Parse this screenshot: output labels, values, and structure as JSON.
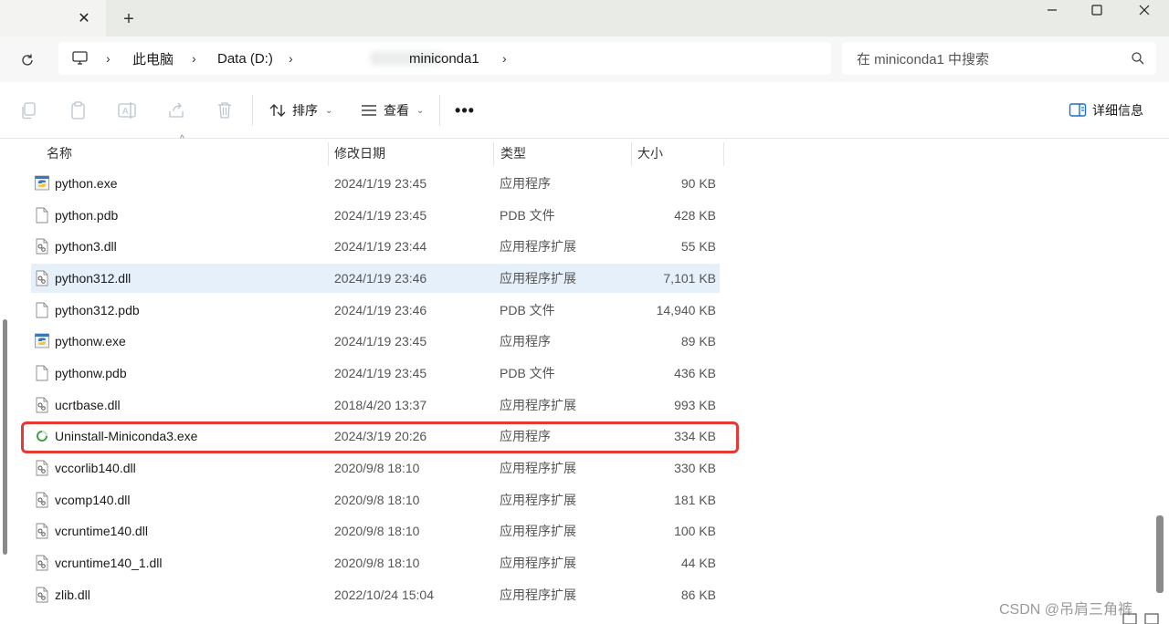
{
  "window": {
    "tab_close": "✕",
    "new_tab": "+",
    "minimize": "—",
    "maximize": "☐",
    "close": "✕"
  },
  "address": {
    "crumbs": [
      "此电脑",
      "Data (D:)",
      "miniconda1"
    ],
    "search_placeholder": "在 miniconda1 中搜索"
  },
  "toolbar": {
    "sort_label": "排序",
    "view_label": "查看",
    "more_label": "•••",
    "details_label": "详细信息"
  },
  "columns": {
    "name": "名称",
    "date": "修改日期",
    "type": "类型",
    "size": "大小"
  },
  "files": [
    {
      "name": "python.exe",
      "date": "2024/1/19 23:45",
      "type": "应用程序",
      "size": "90 KB",
      "icon": "python-exe-icon"
    },
    {
      "name": "python.pdb",
      "date": "2024/1/19 23:45",
      "type": "PDB 文件",
      "size": "428 KB",
      "icon": "file-icon"
    },
    {
      "name": "python3.dll",
      "date": "2024/1/19 23:44",
      "type": "应用程序扩展",
      "size": "55 KB",
      "icon": "dll-icon"
    },
    {
      "name": "python312.dll",
      "date": "2024/1/19 23:46",
      "type": "应用程序扩展",
      "size": "7,101 KB",
      "icon": "dll-icon"
    },
    {
      "name": "python312.pdb",
      "date": "2024/1/19 23:46",
      "type": "PDB 文件",
      "size": "14,940 KB",
      "icon": "file-icon"
    },
    {
      "name": "pythonw.exe",
      "date": "2024/1/19 23:45",
      "type": "应用程序",
      "size": "89 KB",
      "icon": "python-exe-icon"
    },
    {
      "name": "pythonw.pdb",
      "date": "2024/1/19 23:45",
      "type": "PDB 文件",
      "size": "436 KB",
      "icon": "file-icon"
    },
    {
      "name": "ucrtbase.dll",
      "date": "2018/4/20 13:37",
      "type": "应用程序扩展",
      "size": "993 KB",
      "icon": "dll-icon"
    },
    {
      "name": "Uninstall-Miniconda3.exe",
      "date": "2024/3/19 20:26",
      "type": "应用程序",
      "size": "334 KB",
      "icon": "uninstall-icon"
    },
    {
      "name": "vccorlib140.dll",
      "date": "2020/9/8 18:10",
      "type": "应用程序扩展",
      "size": "330 KB",
      "icon": "dll-icon"
    },
    {
      "name": "vcomp140.dll",
      "date": "2020/9/8 18:10",
      "type": "应用程序扩展",
      "size": "181 KB",
      "icon": "dll-icon"
    },
    {
      "name": "vcruntime140.dll",
      "date": "2020/9/8 18:10",
      "type": "应用程序扩展",
      "size": "100 KB",
      "icon": "dll-icon"
    },
    {
      "name": "vcruntime140_1.dll",
      "date": "2020/9/8 18:10",
      "type": "应用程序扩展",
      "size": "44 KB",
      "icon": "dll-icon"
    },
    {
      "name": "zlib.dll",
      "date": "2022/10/24 15:04",
      "type": "应用程序扩展",
      "size": "86 KB",
      "icon": "dll-icon"
    }
  ],
  "selected_row": 3,
  "highlighted_row": 8,
  "highlight_color": "#e53935",
  "watermark": "CSDN @吊肩三角裤"
}
